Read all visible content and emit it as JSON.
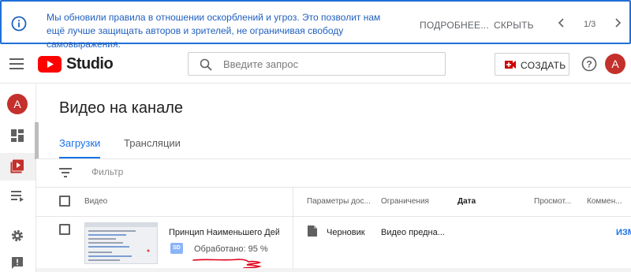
{
  "banner": {
    "message": "Мы обновили правила в отношении оскорблений и угроз. Это позволит нам ещё лучше защищать авторов и зрителей, не ограничивая свободу самовыражения.",
    "more_label": "ПОДРОБНЕЕ...",
    "hide_label": "СКРЫТЬ",
    "pager": "1/3"
  },
  "header": {
    "logo_text": "Studio",
    "search_placeholder": "Введите запрос",
    "create_label": "СОЗДАТЬ",
    "avatar_letter": "A"
  },
  "sidebar": {
    "avatar_letter": "A",
    "items": [
      {
        "icon": "dashboard-icon"
      },
      {
        "icon": "content-icon",
        "active": true
      },
      {
        "icon": "playlists-icon"
      },
      {
        "icon": "settings-icon"
      },
      {
        "icon": "feedback-icon"
      }
    ]
  },
  "main": {
    "title": "Видео на канале",
    "tabs": [
      {
        "label": "Загрузки",
        "active": true
      },
      {
        "label": "Трансляции",
        "active": false
      }
    ],
    "filter_label": "Фильтр",
    "columns": {
      "video": "Видео",
      "visibility": "Параметры дос...",
      "restrictions": "Ограничения",
      "date": "Дата",
      "views": "Просмот...",
      "comments": "Коммен..."
    },
    "rows": [
      {
        "title": "Принцип Наименьшего Дей...",
        "quality_badge": "SD",
        "status": "Обработано: 95 %",
        "visibility": "Черновик",
        "restrictions": "Видео предна...",
        "edit_link": "ИЗМ..."
      }
    ]
  },
  "colors": {
    "accent": "#1a73e8",
    "banner_border": "#1f6fd6",
    "brand_red": "#ff0000",
    "avatar": "#c4302b",
    "annotation": "#e0001a"
  }
}
